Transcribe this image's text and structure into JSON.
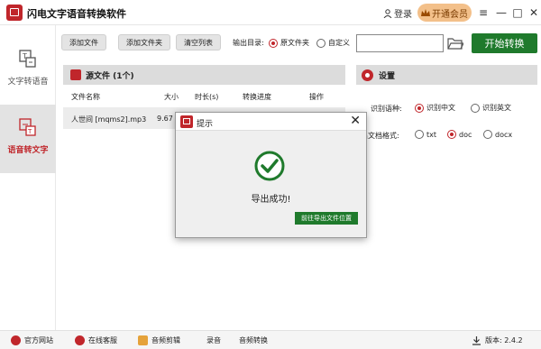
{
  "app": {
    "title": "闪电文字语音转换软件"
  },
  "titlebar": {
    "login_label": "登录",
    "vip_label": "开通会员"
  },
  "sidebar": {
    "items": [
      {
        "label": "文字转语音",
        "active": false
      },
      {
        "label": "语音转文字",
        "active": true
      }
    ]
  },
  "toolbar": {
    "add_file": "添加文件",
    "add_folder": "添加文件夹",
    "clear_list": "清空列表",
    "output_dir_label": "输出目录:",
    "dir_options": [
      "原文件夹",
      "自定义"
    ],
    "dir_selected": "原文件夹",
    "path_value": "",
    "start_button": "开始转换"
  },
  "file_panel": {
    "title": "源文件 (1个)",
    "columns": [
      "文件名称",
      "大小",
      "时长(s)",
      "转换进度",
      "操作"
    ],
    "rows": [
      {
        "name": "人世间 [mqms2].mp3",
        "size": "9.67",
        "duration": "",
        "progress": "",
        "action": ""
      }
    ]
  },
  "settings": {
    "title": "设置",
    "language_label": "识别语种:",
    "language_options": [
      "识别中文",
      "识别英文"
    ],
    "language_selected": "识别中文",
    "format_label": "出文档格式:",
    "format_options": [
      "txt",
      "doc",
      "docx"
    ],
    "format_selected": "doc"
  },
  "dialog": {
    "title": "提示",
    "message": "导出成功!",
    "button": "前往导出文件位置"
  },
  "bottombar": {
    "items": [
      "官方网站",
      "在线客服",
      "音频剪辑",
      "录音",
      "音频转换"
    ],
    "version": "版本: 2.4.2"
  },
  "colors": {
    "accent": "#c0262b",
    "primary_green": "#1f7a2c",
    "vip_gold": "#f3c08a"
  }
}
